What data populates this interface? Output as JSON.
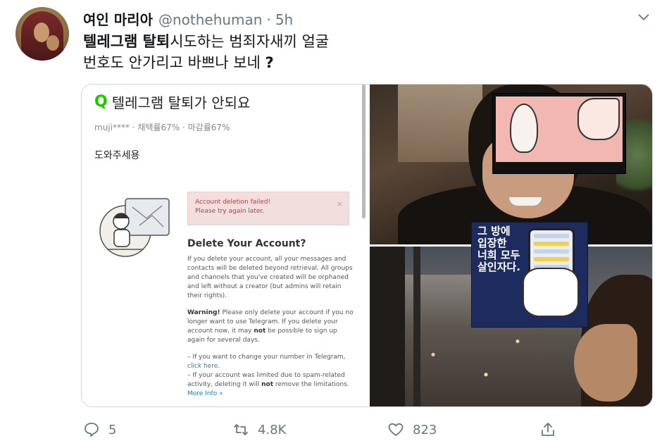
{
  "tweet": {
    "author_name": "여인 마리아",
    "handle": "@nothehuman",
    "separator": "·",
    "time": "5h",
    "text_bold": "텔레그램 탈퇴",
    "text_rest_line1": "시도하는 범죄자새끼 얼굴",
    "text_line2": "번호도 안가리고 바쁘나 보네 ",
    "text_q": "?"
  },
  "media": {
    "question_title": "텔레그램 탈퇴가 안되요",
    "question_mark": "Q",
    "question_meta": "muji**** · 채택률67% · 마감률67%",
    "question_body": "도와주세용",
    "alert_line1": "Account deletion failed!",
    "alert_line2": "Please try again later.",
    "alert_close": "×",
    "delete_title": "Delete Your Account?",
    "delete_p1": "If you delete your account, all your messages and contacts will be deleted beyond retrieval. All groups and channels that you've created will be orphaned and left without a creator (but admins will retain their rights).",
    "warning_label": "Warning!",
    "delete_p2a": " Please only delete your account if you no longer want to use Telegram. If you delete your account now, it may ",
    "delete_p2_not": "not",
    "delete_p2b": " be possible to sign up again for several days.",
    "delete_p3a": "– If you want to change your number in Telegram, ",
    "click_here": "click here",
    "delete_p3b": ".",
    "delete_p4a": "– If your account was limited due to spam-related activity, deleting it will ",
    "delete_p4_not": "not",
    "delete_p4b": " remove the limitations.",
    "more_info": "More Info »",
    "poster_text_1": "그 방에",
    "poster_text_2": "입장한",
    "poster_text_3": "너희 모두",
    "poster_text_4": "살인자다."
  },
  "actions": {
    "reply_count": "5",
    "retweet_count": "4.8K",
    "like_count": "823"
  },
  "colors": {
    "text": "#14171a",
    "muted": "#657786",
    "border": "#ccd6dd",
    "naver_green": "#1ec800",
    "alert_bg": "#f3dede",
    "link": "#2a7ab8"
  },
  "icons": [
    "chevron-down-icon",
    "reply-icon",
    "retweet-icon",
    "like-icon",
    "share-icon"
  ]
}
